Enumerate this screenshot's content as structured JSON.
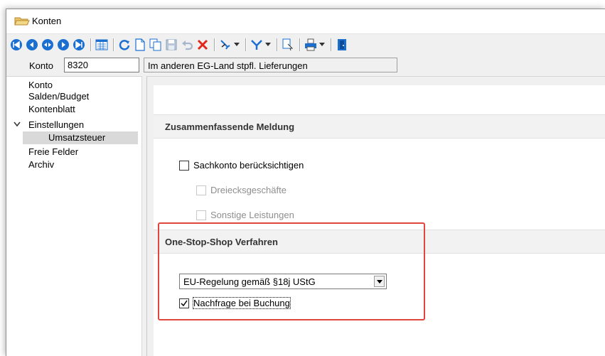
{
  "window": {
    "title": "Konten",
    "icon": "folder-open-icon"
  },
  "toolbar": {
    "buttons": [
      "first-record-icon",
      "previous-record-icon",
      "jump-record-icon",
      "next-record-icon",
      "last-record-icon",
      "list-view-icon",
      "refresh-icon",
      "new-icon",
      "copy-icon",
      "save-icon",
      "undo-icon",
      "delete-icon",
      "tools-icon",
      "filter-icon",
      "search-icon",
      "print-icon",
      "exit-icon"
    ]
  },
  "konto": {
    "label": "Konto",
    "value": "8320",
    "description": "Im anderen EG-Land stpfl. Lieferungen"
  },
  "nav": {
    "items": [
      {
        "label": "Konto"
      },
      {
        "label": "Salden/Budget"
      },
      {
        "label": "Kontenblatt"
      },
      {
        "label": "Einstellungen"
      },
      {
        "label": "Umsatzsteuer",
        "selected": true
      },
      {
        "label": "Freie Felder"
      },
      {
        "label": "Archiv"
      }
    ]
  },
  "zm": {
    "heading": "Zusammenfassende Meldung",
    "sachkonto": {
      "label": "Sachkonto berücksichtigen",
      "checked": false
    },
    "dreieck": {
      "label": "Dreiecksgeschäfte",
      "checked": false,
      "enabled": false
    },
    "sonstige": {
      "label": "Sonstige Leistungen",
      "checked": false,
      "enabled": false
    }
  },
  "oss": {
    "heading": "One-Stop-Shop Verfahren",
    "select_value": "EU-Regelung gemäß §18j UStG",
    "nachfrage": {
      "label": "Nachfrage bei Buchung",
      "checked": true
    }
  },
  "colors": {
    "nav_blue": "#1a6fd1",
    "highlight_red": "#e2453e",
    "selection_gray": "#d9d9d9"
  }
}
